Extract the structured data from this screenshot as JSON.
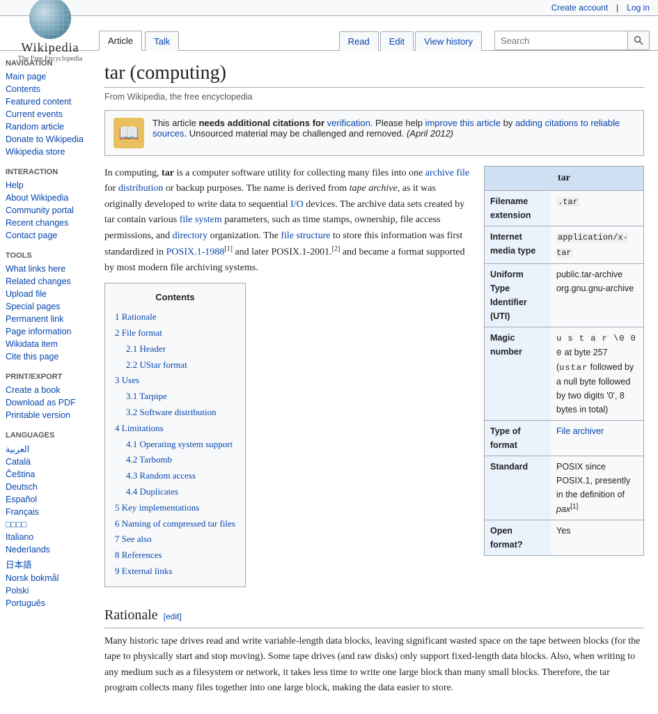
{
  "topbar": {
    "create_account": "Create account",
    "log_in": "Log in"
  },
  "logo": {
    "name": "Wikipedia",
    "tagline": "The Free Encyclopedia"
  },
  "tabs": {
    "article": "Article",
    "talk": "Talk",
    "read": "Read",
    "edit": "Edit",
    "view_history": "View history"
  },
  "search": {
    "placeholder": "Search",
    "button_label": "🔍"
  },
  "sidebar": {
    "navigation_heading": "Navigation",
    "items": [
      "Main page",
      "Contents",
      "Featured content",
      "Current events",
      "Random article",
      "Donate to Wikipedia",
      "Wikipedia store"
    ],
    "interaction_heading": "Interaction",
    "interaction_items": [
      "Help",
      "About Wikipedia",
      "Community portal",
      "Recent changes",
      "Contact page"
    ],
    "tools_heading": "Tools",
    "tools_items": [
      "What links here",
      "Related changes",
      "Upload file",
      "Special pages",
      "Permanent link",
      "Page information",
      "Wikidata item",
      "Cite this page"
    ],
    "print_heading": "Print/export",
    "print_items": [
      "Create a book",
      "Download as PDF",
      "Printable version"
    ],
    "languages_heading": "Languages",
    "language_items": [
      "العربية",
      "Català",
      "Čeština",
      "Deutsch",
      "Español",
      "Français",
      "□□□□",
      "Italiano",
      "Nederlands",
      "日本語",
      "Norsk bokmål",
      "Polski",
      "Português"
    ]
  },
  "page": {
    "title": "tar (computing)",
    "subtitle": "From Wikipedia, the free encyclopedia"
  },
  "notice": {
    "text_bold": "needs additional citations for",
    "text_link": "verification",
    "text_after": ". Please help",
    "improve_link": "improve this article",
    "by_text": "by",
    "citations_link": "adding citations to reliable sources",
    "end_text": ". Unsourced material may be challenged and removed.",
    "date": "(April 2012)",
    "prefix": "This article"
  },
  "article": {
    "intro": "In computing, tar is a computer software utility for collecting many files into one archive file for distribution or backup purposes. The name is derived from tape archive, as it was originally developed to write data to sequential I/O devices. The archive data sets created by tar contain various file system parameters, such as time stamps, ownership, file access permissions, and directory organization. The file structure to store this information was first standardized in POSIX.1-1988 and later POSIX.1-2001. and became a format supported by most modern file archiving systems."
  },
  "contents": {
    "title": "Contents",
    "items": [
      {
        "num": "1",
        "label": "Rationale",
        "sub": []
      },
      {
        "num": "2",
        "label": "File format",
        "sub": [
          {
            "num": "2.1",
            "label": "Header"
          },
          {
            "num": "2.2",
            "label": "UStar format"
          }
        ]
      },
      {
        "num": "3",
        "label": "Uses",
        "sub": [
          {
            "num": "3.1",
            "label": "Tarpipe"
          },
          {
            "num": "3.2",
            "label": "Software distribution"
          }
        ]
      },
      {
        "num": "4",
        "label": "Limitations",
        "sub": [
          {
            "num": "4.1",
            "label": "Operating system support"
          },
          {
            "num": "4.2",
            "label": "Tarbomb"
          },
          {
            "num": "4.3",
            "label": "Random access"
          },
          {
            "num": "4.4",
            "label": "Duplicates"
          }
        ]
      },
      {
        "num": "5",
        "label": "Key implementations",
        "sub": []
      },
      {
        "num": "6",
        "label": "Naming of compressed tar files",
        "sub": []
      },
      {
        "num": "7",
        "label": "See also",
        "sub": []
      },
      {
        "num": "8",
        "label": "References",
        "sub": []
      },
      {
        "num": "9",
        "label": "External links",
        "sub": []
      }
    ]
  },
  "infobox": {
    "title": "tar",
    "rows": [
      {
        "label": "Filename extension",
        "value": ".tar",
        "type": "code"
      },
      {
        "label": "Internet media type",
        "value": "application/x-tar",
        "type": "code"
      },
      {
        "label": "Uniform Type Identifier (UTI)",
        "value": "public.tar-archive org.gnu.gnu-archive",
        "type": "text"
      },
      {
        "label": "Magic number",
        "value": "u s t a r \\0 0 0 at byte 257 (ustar followed by a null byte followed by two digits '0', 8 bytes in total)",
        "type": "text"
      },
      {
        "label": "Type of format",
        "value": "File archiver",
        "type": "link"
      },
      {
        "label": "Standard",
        "value": "POSIX since POSIX.1, presently in the definition of pax",
        "type": "text"
      },
      {
        "label": "Open format?",
        "value": "Yes",
        "type": "text"
      }
    ]
  },
  "rationale": {
    "heading": "Rationale",
    "edit_label": "[edit]",
    "text": "Many historic tape drives read and write variable-length data blocks, leaving significant wasted space on the tape between blocks (for the tape to physically start and stop moving). Some tape drives (and raw disks) only support fixed-length data blocks. Also, when writing to any medium such as a filesystem or network, it takes less time to write one large block than many small blocks. Therefore, the tar program collects many files together into one large block, making the data easier to store."
  }
}
